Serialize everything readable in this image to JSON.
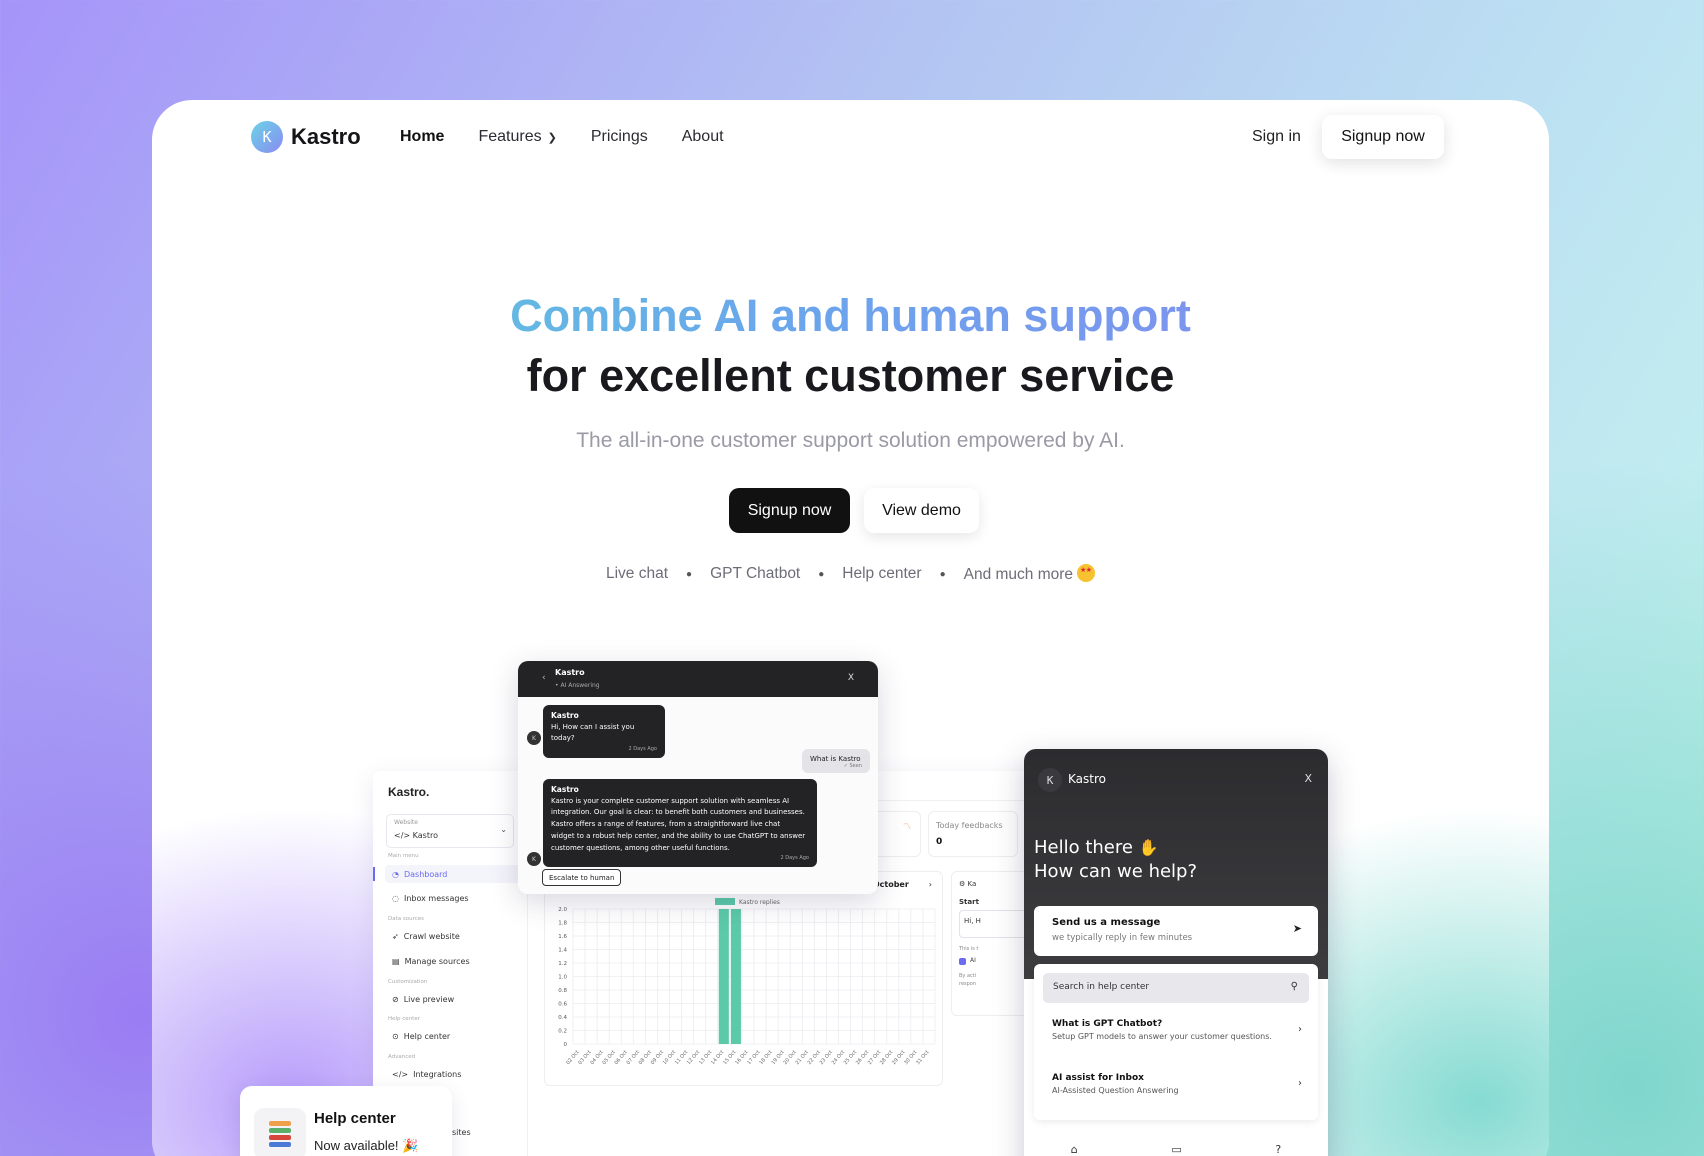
{
  "nav": {
    "logo_mark": "K",
    "logo_text": "Kastro",
    "links": [
      "Home",
      "Features",
      "Pricings",
      "About"
    ],
    "sign_in": "Sign in",
    "signup": "Signup now"
  },
  "hero": {
    "title_line1": "Combine AI and human support",
    "title_line2": "for excellent customer service",
    "subtitle": "The all-in-one customer support solution empowered by AI.",
    "signup": "Signup now",
    "demo": "View demo",
    "features": [
      "Live chat",
      "GPT Chatbot",
      "Help center",
      "And much more"
    ]
  },
  "dashboard": {
    "brand": "Kastro.",
    "website_label": "Website",
    "website_value": "</> Kastro",
    "sections": {
      "main": "Main menu",
      "data": "Data sources",
      "custom": "Customization",
      "help": "Help center",
      "advanced": "Advanced"
    },
    "menu": [
      "Dashboard",
      "Inbox messages",
      "Crawl website",
      "Manage sources",
      "Live preview",
      "Help center",
      "Integrations"
    ],
    "feedbacks_label": "Today feedbacks",
    "feedbacks_value": "0",
    "month": "October",
    "side_card_title": "Ka",
    "side_card_start": "Start",
    "side_card_input": "Hi, H",
    "side_card_note": "This is t",
    "side_card_check": "AI",
    "side_card_note2a": "By acti",
    "side_card_note2b": "respon"
  },
  "chart_data": {
    "type": "bar",
    "legend": "Kastro replies",
    "categories": [
      "02 Oct",
      "03 Oct",
      "04 Oct",
      "05 Oct",
      "06 Oct",
      "07 Oct",
      "08 Oct",
      "09 Oct",
      "10 Oct",
      "11 Oct",
      "12 Oct",
      "13 Oct",
      "14 Oct",
      "15 Oct",
      "16 Oct",
      "17 Oct",
      "18 Oct",
      "19 Oct",
      "20 Oct",
      "21 Oct",
      "22 Oct",
      "23 Oct",
      "24 Oct",
      "25 Oct",
      "26 Oct",
      "27 Oct",
      "28 Oct",
      "29 Oct",
      "30 Oct",
      "31 Oct"
    ],
    "values": [
      0,
      0,
      0,
      0,
      0,
      0,
      0,
      0,
      0,
      0,
      0,
      0,
      2,
      2,
      0,
      0,
      0,
      0,
      0,
      0,
      0,
      0,
      0,
      0,
      0,
      0,
      0,
      0,
      0,
      0
    ],
    "yticks": [
      "2.0",
      "1.8",
      "1.6",
      "1.4",
      "1.2",
      "1.0",
      "0.8",
      "0.6",
      "0.4",
      "0.2",
      "0"
    ],
    "ylim": [
      0,
      2
    ],
    "color": "#5ccaa9"
  },
  "chat": {
    "name": "Kastro",
    "status": "• AI Answering",
    "close": "X",
    "avatar": "K",
    "msg1_who": "Kastro",
    "msg1": "Hi, How can I assist you today?",
    "msg1_time": "2 Days Ago",
    "user_msg": "What is Kastro",
    "user_time": "✓ Seen",
    "msg2_who": "Kastro",
    "msg2_lines": [
      "Kastro is your complete customer support solution with seamless AI",
      "integration. Our goal is clear: to benefit both customers and businesses.",
      "Kastro offers a range of features, from a straightforward live chat",
      "widget to a robust help center, and the ability to use ChatGPT to answer",
      "customer questions, among other useful functions."
    ],
    "msg2_time": "2 Days Ago",
    "escalate": "Escalate to human"
  },
  "help_widget": {
    "mark": "K",
    "name": "Kastro",
    "close": "X",
    "hello": "Hello there",
    "how": "How can we help?",
    "send_title": "Send us a message",
    "send_sub": "we typically reply in few minutes",
    "search_placeholder": "Search in help center",
    "items": [
      {
        "title": "What is GPT Chatbot?",
        "sub": "Setup GPT models to answer your customer questions."
      },
      {
        "title": "AI assist for Inbox",
        "sub": "AI-Assisted Question Answering"
      }
    ]
  },
  "help_card": {
    "title": "Help center",
    "sub": "Now available!",
    "sites": "sites"
  },
  "colors": {
    "accent": "#6b6bf0",
    "dark": "#111111",
    "bar": "#5ccaa9"
  }
}
